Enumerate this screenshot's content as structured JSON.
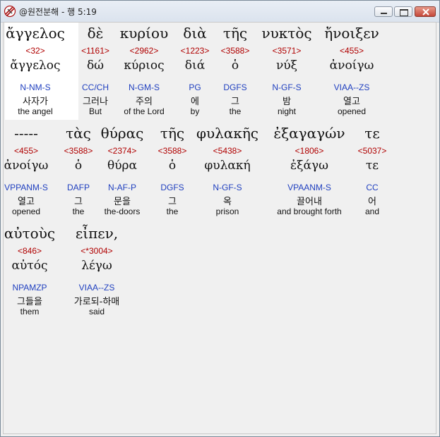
{
  "window": {
    "title": "@원전분해 - 행 5:19"
  },
  "rows": [
    [
      {
        "greek": "ἄγγελος",
        "strong": "<32>",
        "lemma": "ἄγγελος",
        "parse": "N-NM-S",
        "korean": "사자가",
        "english": "the angel"
      },
      {
        "greek": "δὲ",
        "strong": "<1161>",
        "lemma": "δώ",
        "parse": "CC/CH",
        "korean": "그러나",
        "english": "But"
      },
      {
        "greek": "κυρίου",
        "strong": "<2962>",
        "lemma": "κύριος",
        "parse": "N-GM-S",
        "korean": "주의",
        "english": "of the Lord"
      },
      {
        "greek": "διὰ",
        "strong": "<1223>",
        "lemma": "διά",
        "parse": "PG",
        "korean": "에",
        "english": "by"
      },
      {
        "greek": "τῆς",
        "strong": "<3588>",
        "lemma": "ὁ",
        "parse": "DGFS",
        "korean": "그",
        "english": "the"
      },
      {
        "greek": "νυκτὸς",
        "strong": "<3571>",
        "lemma": "νύξ",
        "parse": "N-GF-S",
        "korean": "밤",
        "english": "night"
      },
      {
        "greek": "ἤνοιξεν",
        "strong": "<455>",
        "lemma": "ἀνοίγω",
        "parse": "VIAA--ZS",
        "korean": "열고",
        "english": "opened"
      }
    ],
    [
      {
        "greek": "-----",
        "strong": "<455>",
        "lemma": "ἀνοίγω",
        "parse": "VPPANM-S",
        "korean": "열고",
        "english": "opened"
      },
      {
        "greek": "τὰς",
        "strong": "<3588>",
        "lemma": "ὁ",
        "parse": "DAFP",
        "korean": "그",
        "english": "the"
      },
      {
        "greek": "θύρας",
        "strong": "<2374>",
        "lemma": "θύρα",
        "parse": "N-AF-P",
        "korean": "문을",
        "english": "the-doors"
      },
      {
        "greek": "τῆς",
        "strong": "<3588>",
        "lemma": "ὁ",
        "parse": "DGFS",
        "korean": "그",
        "english": "the"
      },
      {
        "greek": "φυλακῆς",
        "strong": "<5438>",
        "lemma": "φυλακή",
        "parse": "N-GF-S",
        "korean": "옥",
        "english": "prison"
      },
      {
        "greek": "ἐξαγαγών",
        "strong": "<1806>",
        "lemma": "ἐξάγω",
        "parse": "VPAANM-S",
        "korean": "끌어내",
        "english": "and brought forth"
      },
      {
        "greek": "τε",
        "strong": "<5037>",
        "lemma": "τε",
        "parse": "CC",
        "korean": "어",
        "english": "and"
      }
    ],
    [
      {
        "greek": "αὐτοὺς",
        "strong": "<846>",
        "lemma": "αὐτός",
        "parse": "NPAMZP",
        "korean": "그들을",
        "english": "them"
      },
      {
        "greek": "εἶπεν,",
        "strong": "<*3004>",
        "lemma": "λέγω",
        "parse": "VIAA--ZS",
        "korean": "가로되-하매",
        "english": "said"
      }
    ]
  ]
}
